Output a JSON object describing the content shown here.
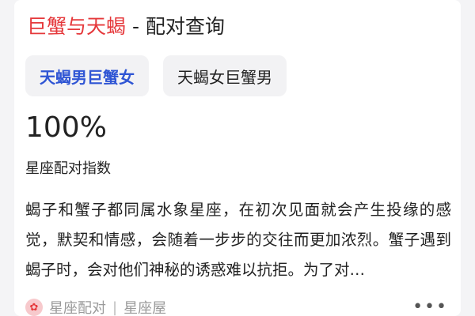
{
  "header": {
    "title_highlight": "巨蟹与天蝎",
    "title_rest": " - 配对查询"
  },
  "tabs": [
    {
      "label": "天蝎男巨蟹女",
      "active": true
    },
    {
      "label": "天蝎女巨蟹男",
      "active": false
    }
  ],
  "result": {
    "percent": "100%",
    "label": "星座配对指数"
  },
  "description": "蝎子和蟹子都同属水象星座，在初次见面就会产生投缘的感觉，默契和情感，会随着一步步的交往而更加浓烈。蟹子遇到蝎子时，会对他们神秘的诱惑难以抗拒。为了对…",
  "footer": {
    "source_category": "星座配对",
    "separator": "|",
    "source_site": "星座屋",
    "logo_icon": "flower-icon",
    "more_icon": "more-icon"
  },
  "colors": {
    "highlight": "#e5383b",
    "active_tab": "#2f55d4"
  }
}
